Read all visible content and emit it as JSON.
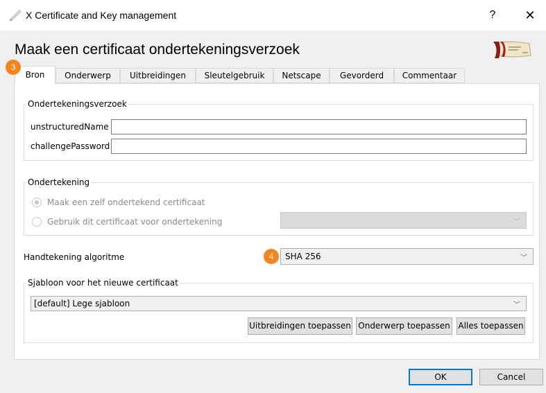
{
  "window": {
    "title": "X Certificate and Key management",
    "help": "?",
    "close": "✕"
  },
  "page_title": "Maak een certificaat ondertekeningsverzoek",
  "badges": {
    "tabs": "3",
    "algorithm": "4"
  },
  "tabs": [
    {
      "label": "Bron",
      "active": true
    },
    {
      "label": "Onderwerp"
    },
    {
      "label": "Uitbreidingen"
    },
    {
      "label": "Sleutelgebruik"
    },
    {
      "label": "Netscape"
    },
    {
      "label": "Gevorderd"
    },
    {
      "label": "Commentaar"
    }
  ],
  "request_group": {
    "title": "Ondertekeningsverzoek",
    "unstructured_name_label": "unstructuredName",
    "unstructured_name_value": "",
    "challenge_password_label": "challengePassword",
    "challenge_password_value": ""
  },
  "signing_group": {
    "title": "Ondertekening",
    "self_signed_label": "Maak een zelf ondertekend certificaat",
    "use_cert_label": "Gebruik dit certificaat voor ondertekening",
    "self_signed_checked": true,
    "use_cert_checked": false,
    "cert_select_value": ""
  },
  "algorithm": {
    "label": "Handtekening algoritme",
    "value": "SHA 256"
  },
  "template_group": {
    "title": "Sjabloon voor het nieuwe certificaat",
    "select_value": "[default] Lege sjabloon",
    "apply_extensions": "Uitbreidingen toepassen",
    "apply_subject": "Onderwerp toepassen",
    "apply_all": "Alles toepassen"
  },
  "footer": {
    "ok": "OK",
    "cancel": "Cancel"
  },
  "colors": {
    "badge": "#f5841f",
    "ok_border": "#0078d7"
  },
  "icons": {
    "app": "certificate-quill-icon",
    "chevron": "chevron-down-icon",
    "logo": "parchment-logo"
  }
}
